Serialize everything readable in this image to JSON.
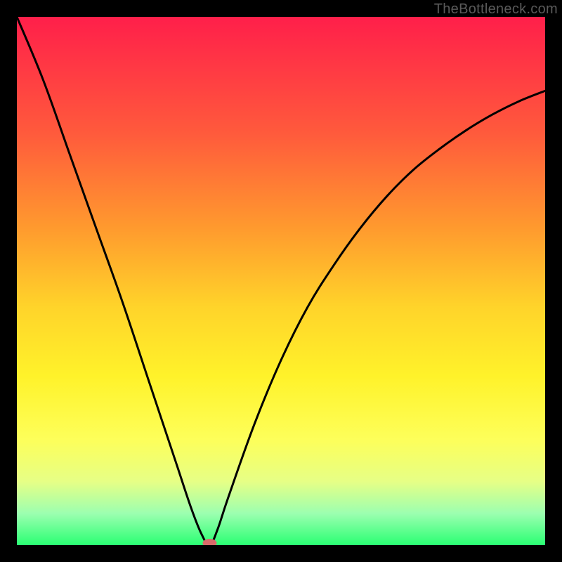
{
  "watermark": "TheBottleneck.com",
  "chart_data": {
    "type": "line",
    "title": "",
    "xlabel": "",
    "ylabel": "",
    "xlim": [
      0,
      100
    ],
    "ylim": [
      0,
      100
    ],
    "grid": false,
    "legend": false,
    "series": [
      {
        "name": "left-branch",
        "x": [
          0,
          5,
          10,
          15,
          20,
          25,
          30,
          33,
          35,
          36.5
        ],
        "y": [
          100,
          88,
          74,
          60,
          46,
          31,
          16,
          7,
          2,
          0
        ]
      },
      {
        "name": "right-branch",
        "x": [
          36.5,
          38,
          40,
          45,
          50,
          55,
          60,
          65,
          70,
          75,
          80,
          85,
          90,
          95,
          100
        ],
        "y": [
          0,
          3,
          9,
          23,
          35,
          45,
          53,
          60,
          66,
          71,
          75,
          78.5,
          81.5,
          84,
          86
        ]
      }
    ],
    "marker": {
      "x": 36.5,
      "y": 0,
      "color": "#d96a6a"
    },
    "gradient_stops": [
      {
        "pos": 0.0,
        "color": "#ff1f4a"
      },
      {
        "pos": 0.22,
        "color": "#ff5a3c"
      },
      {
        "pos": 0.4,
        "color": "#ff9a2e"
      },
      {
        "pos": 0.55,
        "color": "#ffd42a"
      },
      {
        "pos": 0.68,
        "color": "#fff22a"
      },
      {
        "pos": 0.8,
        "color": "#fdff5a"
      },
      {
        "pos": 0.88,
        "color": "#e6ff86"
      },
      {
        "pos": 0.94,
        "color": "#9cffb0"
      },
      {
        "pos": 1.0,
        "color": "#2aff73"
      }
    ],
    "annotations": []
  }
}
